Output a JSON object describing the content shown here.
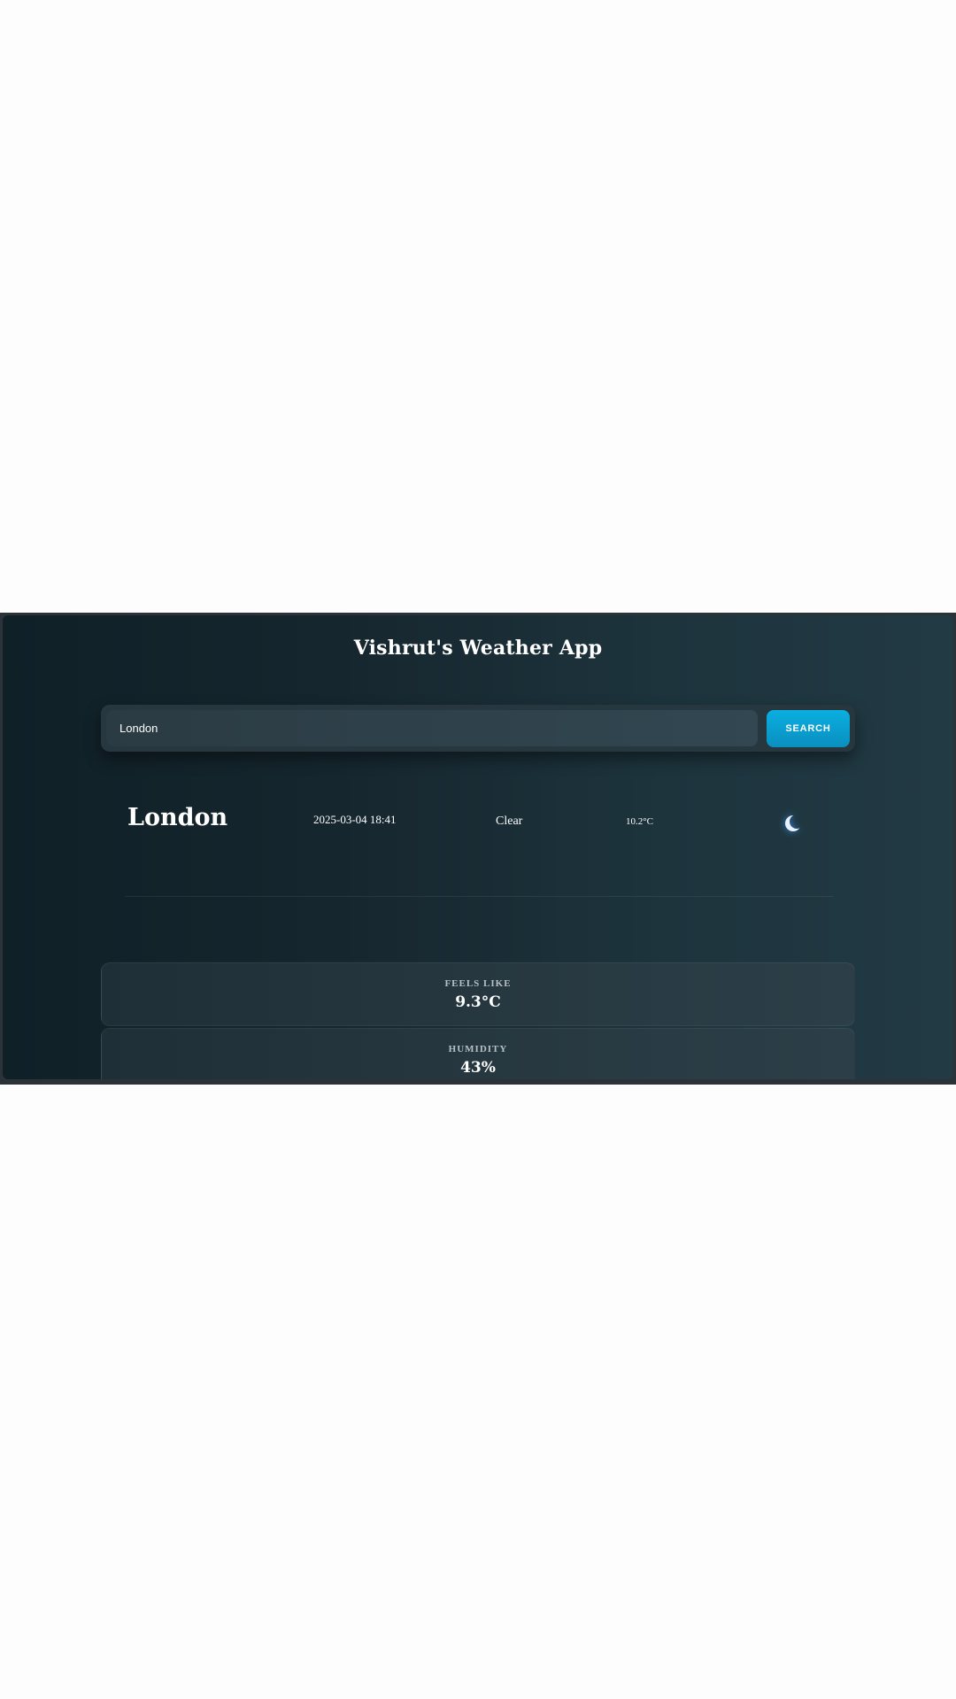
{
  "app": {
    "title": "Vishrut's Weather App"
  },
  "search": {
    "value": "London",
    "button_label": "SEARCH"
  },
  "current": {
    "city": "London",
    "datetime": "2025-03-04 18:41",
    "condition": "Clear",
    "temperature": "10.2°C",
    "icon": "moon-icon"
  },
  "details": {
    "feels_like": {
      "label": "FEELS LIKE",
      "value": "9.3°C"
    },
    "humidity": {
      "label": "HUMIDITY",
      "value": "43%"
    }
  },
  "colors": {
    "accent": "#0aa3d4",
    "background_start": "#102027",
    "background_end": "#223a44"
  }
}
